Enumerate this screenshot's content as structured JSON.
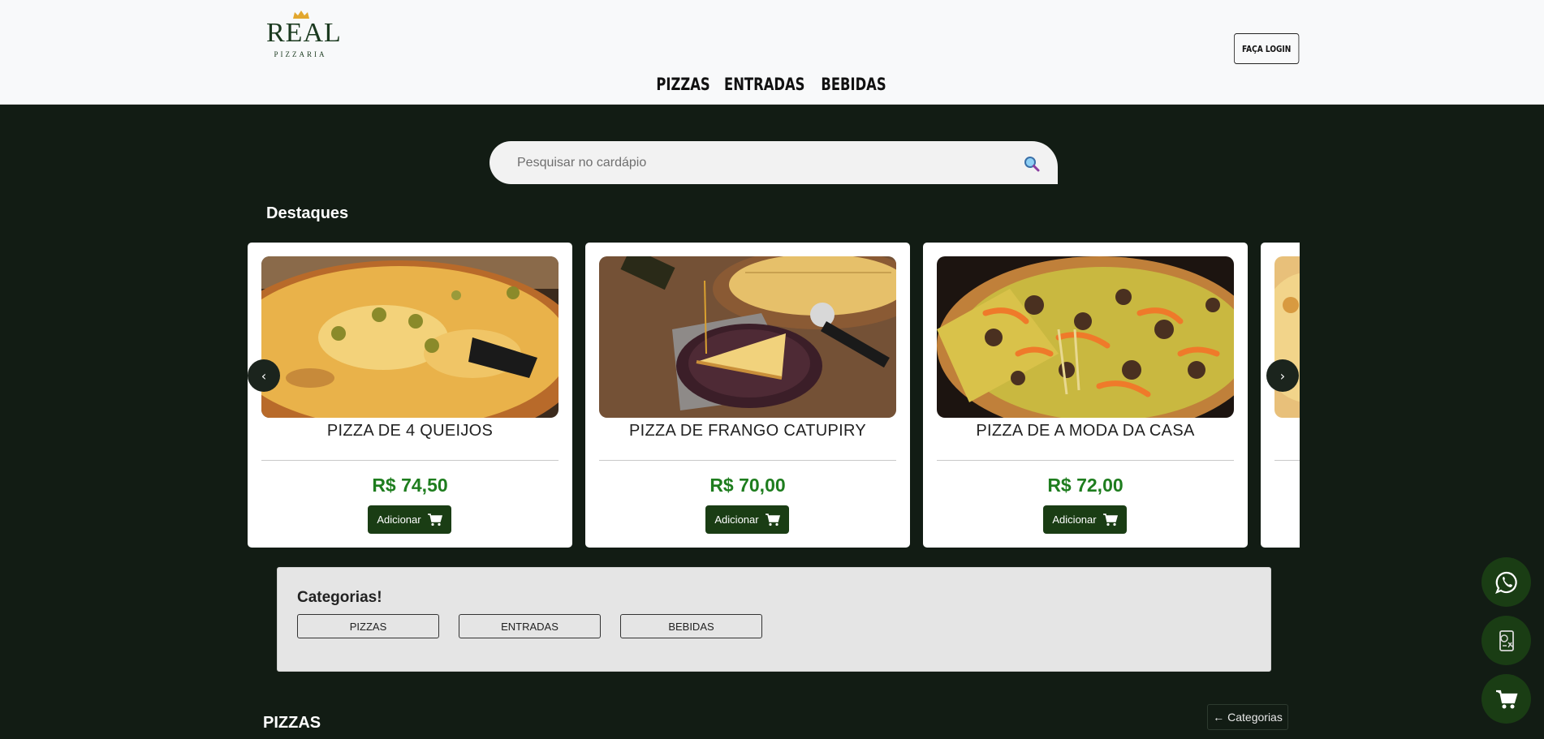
{
  "header": {
    "logo": {
      "title": "REAL",
      "subtitle": "PIZZARIA"
    },
    "login_label": "FAÇA LOGIN",
    "nav": [
      "PIZZAS",
      "ENTRADAS",
      "BEBIDAS"
    ]
  },
  "search": {
    "placeholder": "Pesquisar no cardápio",
    "icon": "search-icon"
  },
  "featured": {
    "title": "Destaques",
    "items": [
      {
        "name": "PIZZA DE 4 QUEIJOS",
        "price": "R$ 74,50",
        "button": "Adicionar"
      },
      {
        "name": "PIZZA DE FRANGO CATUPIRY",
        "price": "R$ 70,00",
        "button": "Adicionar"
      },
      {
        "name": "PIZZA DE A MODA DA CASA",
        "price": "R$ 72,00",
        "button": "Adicionar"
      }
    ],
    "prev_label": "‹",
    "next_label": "›"
  },
  "categories": {
    "title": "Categorias!",
    "items": [
      "PIZZAS",
      "ENTRADAS",
      "BEBIDAS"
    ]
  },
  "pizzas_section": {
    "title": "PIZZAS",
    "back_label": "Categorias",
    "back_arrow": "←"
  },
  "floating": [
    "whatsapp-icon",
    "menu-receipt-icon",
    "cart-icon"
  ],
  "colors": {
    "background": "#121c14",
    "header": "#f8f9fa",
    "accent": "#1a3d14",
    "price": "#1e7d1e",
    "categories_panel": "#e5e5e5"
  }
}
